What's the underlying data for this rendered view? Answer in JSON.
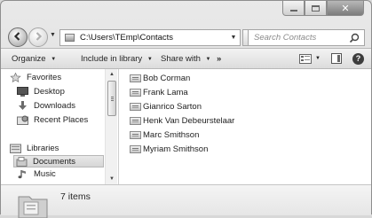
{
  "window": {
    "caption": {
      "minimize": "–",
      "maximize": "□",
      "close": "✕"
    }
  },
  "nav": {
    "back_glyph": "◀",
    "forward_glyph": "▶",
    "recent_glyph": "▼",
    "address_path": "C:\\Users\\TEmp\\Contacts",
    "address_drop_glyph": "▼",
    "refresh_glyph": "→",
    "search_placeholder": "Search Contacts"
  },
  "toolbar": {
    "organize": "Organize",
    "include_in_library": "Include in library",
    "share_with": "Share with",
    "more": "»",
    "caret": "▼"
  },
  "navpane": {
    "favorites_header": "Favorites",
    "favorites": [
      "Desktop",
      "Downloads",
      "Recent Places"
    ],
    "libraries_header": "Libraries",
    "libraries": [
      "Documents",
      "Music"
    ]
  },
  "files": {
    "items": [
      "Bob Corman",
      "Frank Lama",
      "Gianrico Sarton",
      "Henk Van Debeurstelaar",
      "Marc Smithson",
      "Myriam Smithson"
    ]
  },
  "details": {
    "item_count": "7 items"
  },
  "icons": {
    "back": "back-arrow-icon",
    "forward": "forward-arrow-icon",
    "folder": "folder-icon",
    "search": "search-icon",
    "contact": "contact-card-icon",
    "favorites": "star-icon",
    "libraries": "library-icon",
    "help": "help-icon"
  }
}
